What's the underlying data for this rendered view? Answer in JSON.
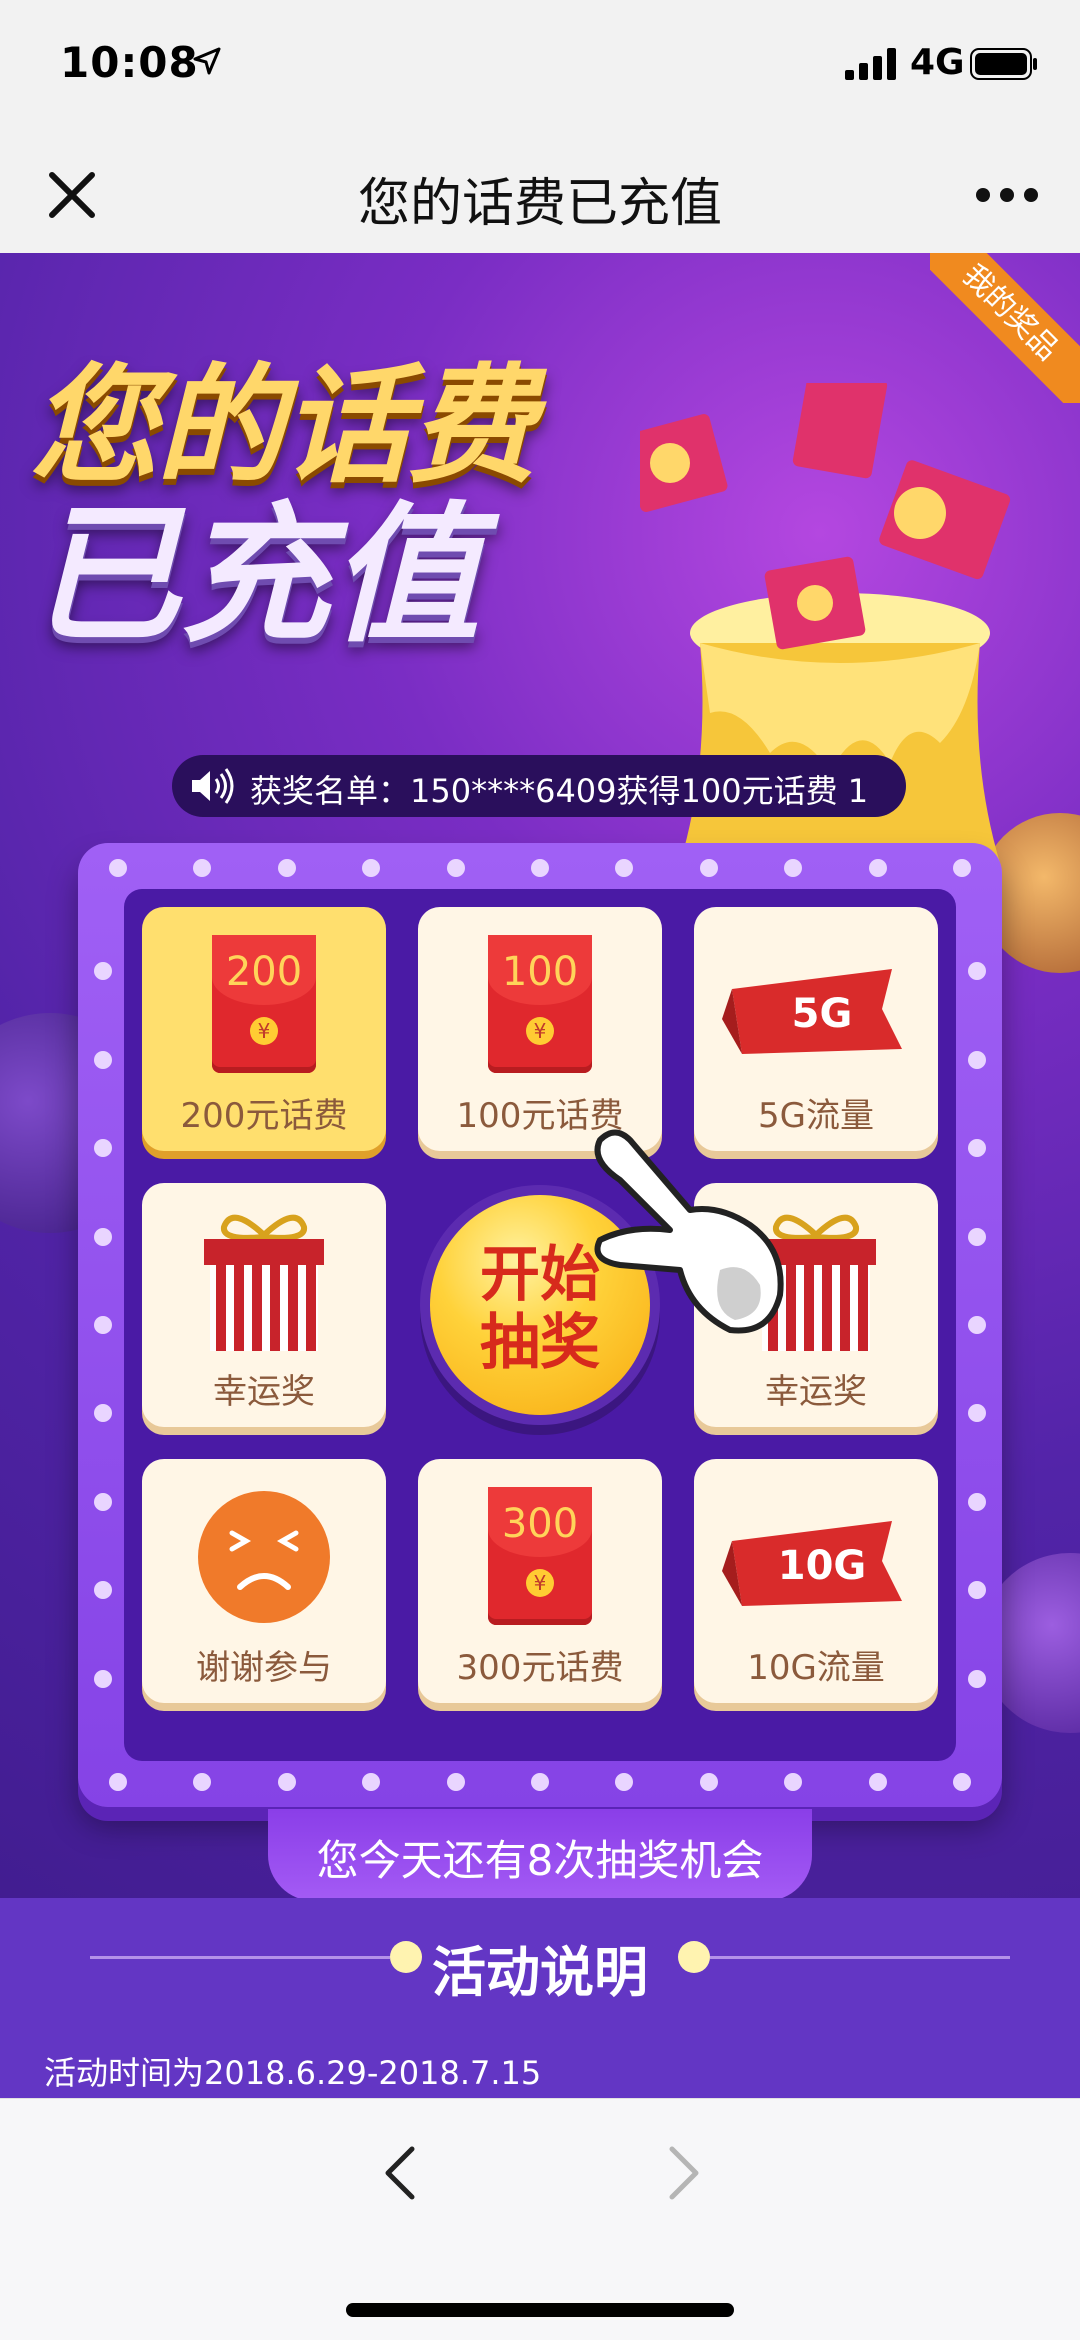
{
  "status": {
    "time": "10:08",
    "network": "4G"
  },
  "nav": {
    "title": "您的话费已充值"
  },
  "hero": {
    "line1": "您的话费",
    "line2": "已充值",
    "my_prizes": "我的奖品"
  },
  "ticker": {
    "text": "获奖名单：150****6409获得100元话费 1"
  },
  "prizes": [
    {
      "label": "200元话费",
      "amount": "200"
    },
    {
      "label": "100元话费",
      "amount": "100"
    },
    {
      "label": "5G流量",
      "badge": "5G"
    },
    {
      "label": "幸运奖"
    },
    {
      "label": "幸运奖"
    },
    {
      "label": "谢谢参与"
    },
    {
      "label": "300元话费",
      "amount": "300"
    },
    {
      "label": "10G流量",
      "badge": "10G"
    }
  ],
  "start_button": {
    "line1": "开始",
    "line2": "抽奖"
  },
  "chances": {
    "text": "您今天还有8次抽奖机会"
  },
  "info": {
    "title": "活动说明",
    "time": "活动时间为2018.6.29-2018.7.15"
  },
  "colors": {
    "purple": "#5224a8",
    "gold": "#ffd76a",
    "red": "#e0282d"
  }
}
